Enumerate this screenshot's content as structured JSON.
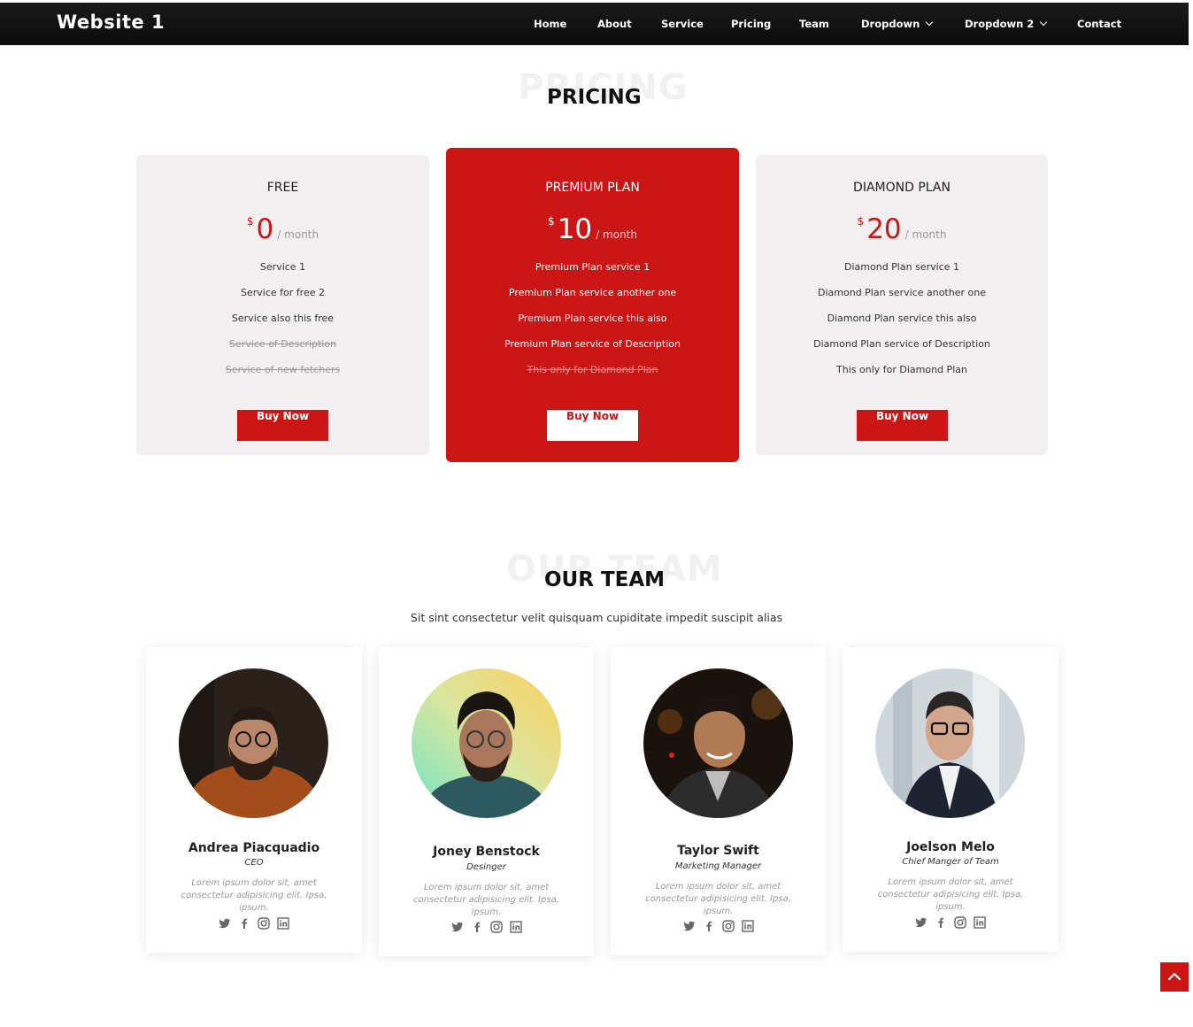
{
  "brand": "Website 1",
  "nav": [
    {
      "label": "Home"
    },
    {
      "label": "About"
    },
    {
      "label": "Service"
    },
    {
      "label": "Pricing"
    },
    {
      "label": "Team"
    },
    {
      "label": "Dropdown"
    },
    {
      "label": "Dropdown 2"
    },
    {
      "label": "Contact"
    }
  ],
  "pricing": {
    "bg_title": "PRICING",
    "title": "PRICING",
    "plans": [
      {
        "name": "FREE",
        "currency": "$",
        "amount": "0",
        "period": "/ month",
        "features": [
          "Service 1",
          "Service for free 2",
          "Service also this free",
          "Service of Description",
          "Service of new fetchers"
        ],
        "unavailable": [
          false,
          false,
          false,
          true,
          true
        ],
        "button": "Buy Now"
      },
      {
        "name": "PREMIUM PLAN",
        "currency": "$",
        "amount": "10",
        "period": "/ month",
        "features": [
          "Premium Plan service 1",
          "Premium Plan service another one",
          "Premium Plan service this also",
          "Premium Plan service of Description",
          "This only for Diamond Plan"
        ],
        "unavailable": [
          false,
          false,
          false,
          false,
          true
        ],
        "button": "Buy Now"
      },
      {
        "name": "DIAMOND PLAN",
        "currency": "$",
        "amount": "20",
        "period": "/ month",
        "features": [
          "Diamond Plan service 1",
          "Diamond Plan service another one",
          "Diamond Plan service this also",
          "Diamond Plan service of Description",
          "This only for Diamond Plan"
        ],
        "unavailable": [
          false,
          false,
          false,
          false,
          false
        ],
        "button": "Buy Now"
      }
    ]
  },
  "team": {
    "bg_title": "OUR TEAM",
    "title": "OUR TEAM",
    "subtitle": "Sit sint consectetur velit quisquam cupiditate impedit suscipit alias",
    "members": [
      {
        "name": "Andrea Piacquadio",
        "role": "CEO",
        "bio": "Lorem ipsum dolor sit, amet consectetur adipisicing elit. Ipsa, ipsum."
      },
      {
        "name": "Joney Benstock",
        "role": "Desinger",
        "bio": "Lorem ipsum dolor sit, amet consectetur adipisicing elit. Ipsa, ipsum."
      },
      {
        "name": "Taylor Swift",
        "role": "Marketing Manager",
        "bio": "Lorem ipsum dolor sit, amet consectetur adipisicing elit. Ipsa, ipsum."
      },
      {
        "name": "Joelson Melo",
        "role": "Chief Manger of Team",
        "bio": "Lorem ipsum dolor sit, amet consectetur adipisicing elit. Ipsa, ipsum."
      }
    ],
    "social_icons": [
      "twitter-icon",
      "facebook-icon",
      "instagram-icon",
      "linkedin-icon"
    ]
  },
  "colors": {
    "accent": "#cc1616",
    "navbar": "#111111",
    "card_bg": "#f1efef"
  },
  "back_to_top_icon": "arrow-up-icon"
}
